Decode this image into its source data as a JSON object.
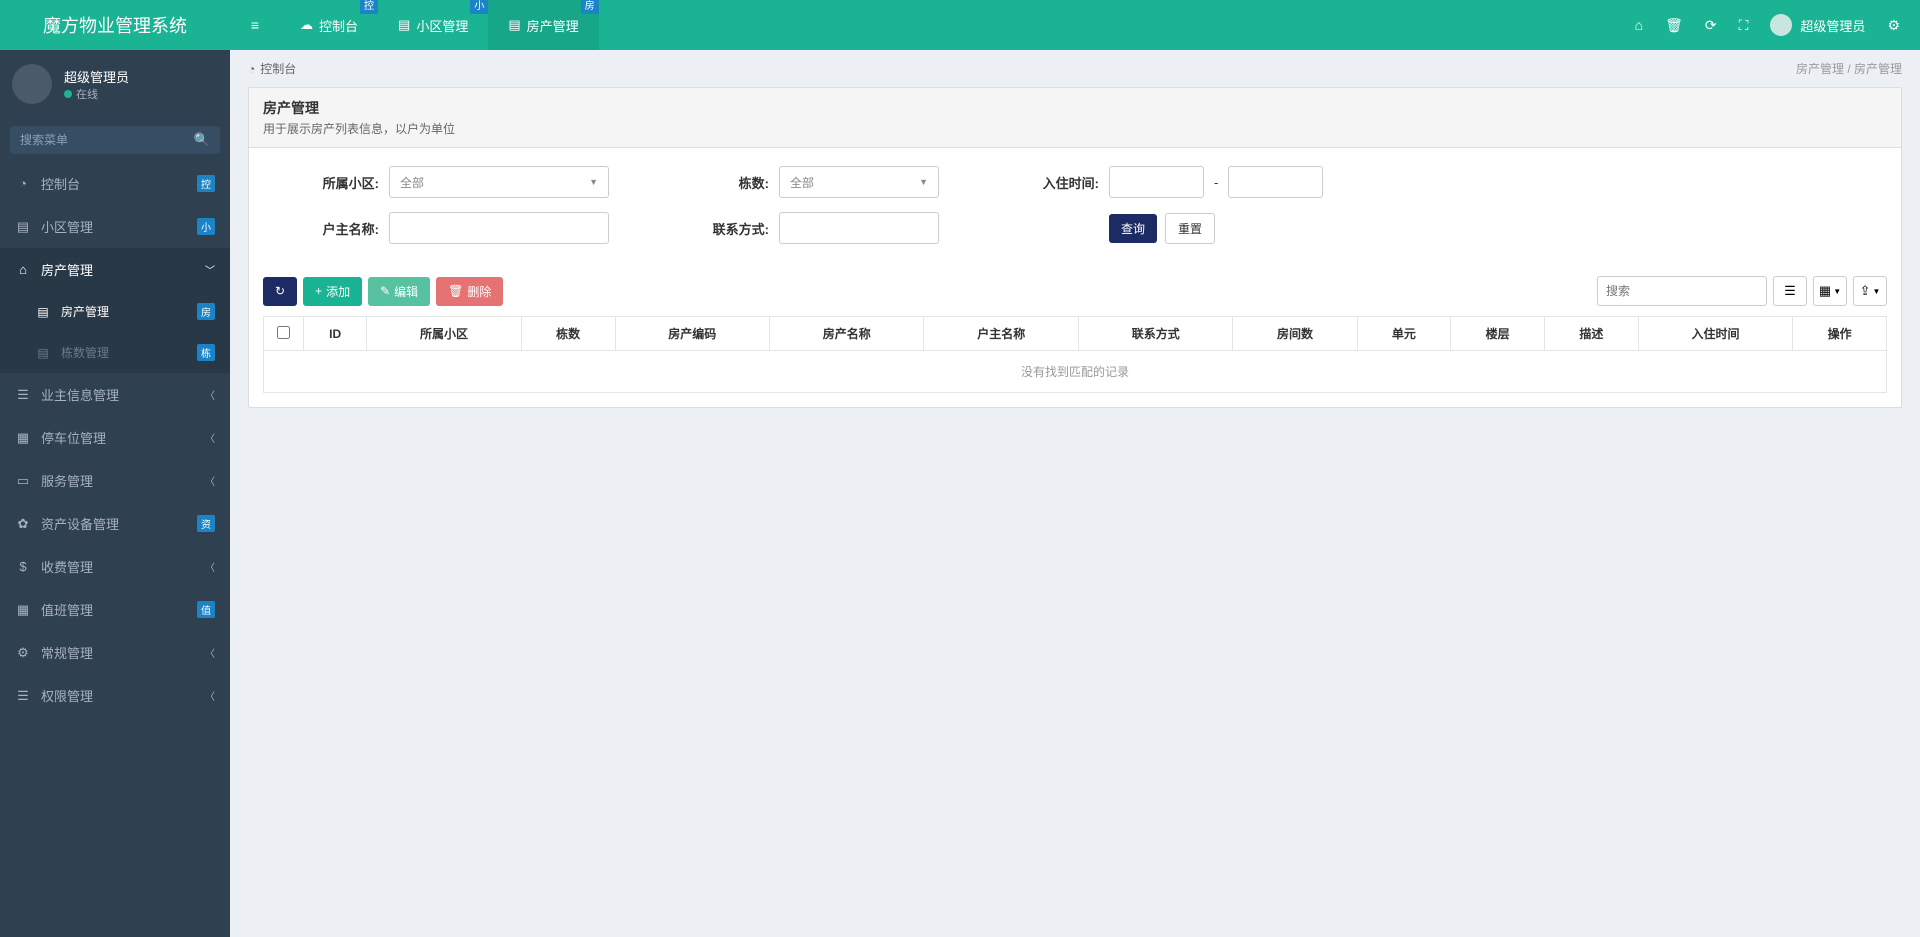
{
  "app": {
    "title": "魔方物业管理系统"
  },
  "tabs": [
    {
      "label": "控制台",
      "badge": "控",
      "icon": "☁"
    },
    {
      "label": "小区管理",
      "badge": "小",
      "icon": "▤"
    },
    {
      "label": "房产管理",
      "badge": "房",
      "icon": "▤",
      "active": true
    }
  ],
  "top_user": {
    "name": "超级管理员"
  },
  "sidebar": {
    "user": {
      "name": "超级管理员",
      "status": "在线"
    },
    "search_placeholder": "搜索菜单",
    "items": [
      {
        "icon": "◔",
        "label": "控制台",
        "badge": "控"
      },
      {
        "icon": "▤",
        "label": "小区管理",
        "badge": "小"
      },
      {
        "icon": "⌂",
        "label": "房产管理",
        "expanded": true,
        "children": [
          {
            "label": "房产管理",
            "badge": "房",
            "active": true
          },
          {
            "label": "栋数管理",
            "badge": "栋",
            "dim": true
          }
        ]
      },
      {
        "icon": "☰",
        "label": "业主信息管理",
        "chev": true
      },
      {
        "icon": "▦",
        "label": "停车位管理",
        "chev": true
      },
      {
        "icon": "▭",
        "label": "服务管理",
        "chev": true
      },
      {
        "icon": "✿",
        "label": "资产设备管理",
        "badge": "资"
      },
      {
        "icon": "$",
        "label": "收费管理",
        "chev": true
      },
      {
        "icon": "▦",
        "label": "值班管理",
        "badge": "值"
      },
      {
        "icon": "⚙",
        "label": "常规管理",
        "chev": true
      },
      {
        "icon": "☰",
        "label": "权限管理",
        "chev": true
      }
    ]
  },
  "breadcrumb": {
    "home": "控制台",
    "path1": "房产管理",
    "path2": "房产管理"
  },
  "panel": {
    "title": "房产管理",
    "desc": "用于展示房产列表信息，以户为单位"
  },
  "filters": {
    "community_label": "所属小区:",
    "community_value": "全部",
    "building_label": "栋数:",
    "building_value": "全部",
    "checkin_label": "入住时间:",
    "owner_label": "户主名称:",
    "contact_label": "联系方式:",
    "query_btn": "查询",
    "reset_btn": "重置"
  },
  "toolbar": {
    "refresh": "↻",
    "add": "添加",
    "edit": "编辑",
    "delete": "删除",
    "search_placeholder": "搜索"
  },
  "table": {
    "columns": [
      "ID",
      "所属小区",
      "栋数",
      "房产编码",
      "房产名称",
      "户主名称",
      "联系方式",
      "房间数",
      "单元",
      "楼层",
      "描述",
      "入住时间",
      "操作"
    ],
    "empty": "没有找到匹配的记录"
  }
}
